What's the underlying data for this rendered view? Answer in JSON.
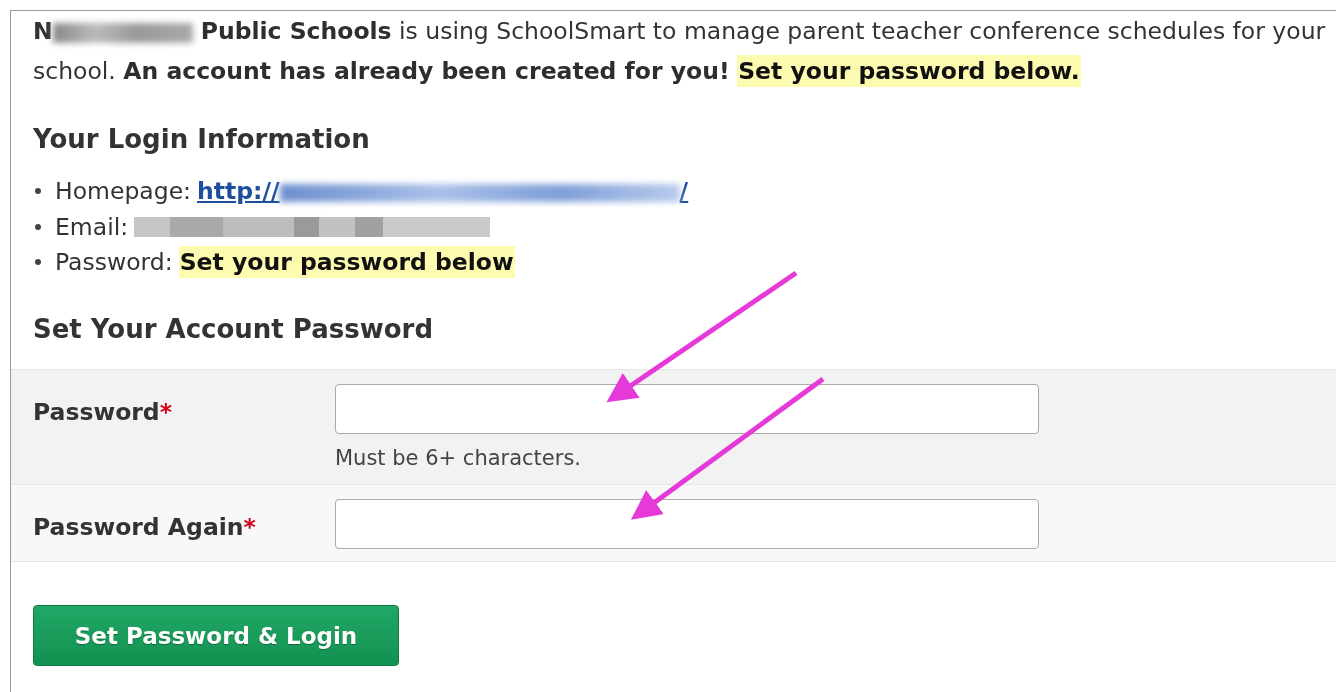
{
  "intro": {
    "initial": "N",
    "text": "**Public Schools** is using SchoolSmart to manage parent teacher conference schedules for your school. **An account has already been created for you!**",
    "highlight": "Set your password below."
  },
  "login_heading": "Your Login Information",
  "login_items": [
    {
      "kind": "link",
      "label": "Homepage:",
      "link_start": "http://",
      "link_end": "/"
    },
    {
      "kind": "redacted",
      "label": "Email:"
    },
    {
      "kind": "highlight",
      "label": "Password:",
      "value": "Set your password below"
    }
  ],
  "form_heading": "Set Your Account Password",
  "fields": [
    {
      "label": "Password",
      "required_mark": "*",
      "hint": "Must be 6+ characters."
    },
    {
      "label": "Password Again",
      "required_mark": "*"
    }
  ],
  "submit": "Set Password & Login"
}
